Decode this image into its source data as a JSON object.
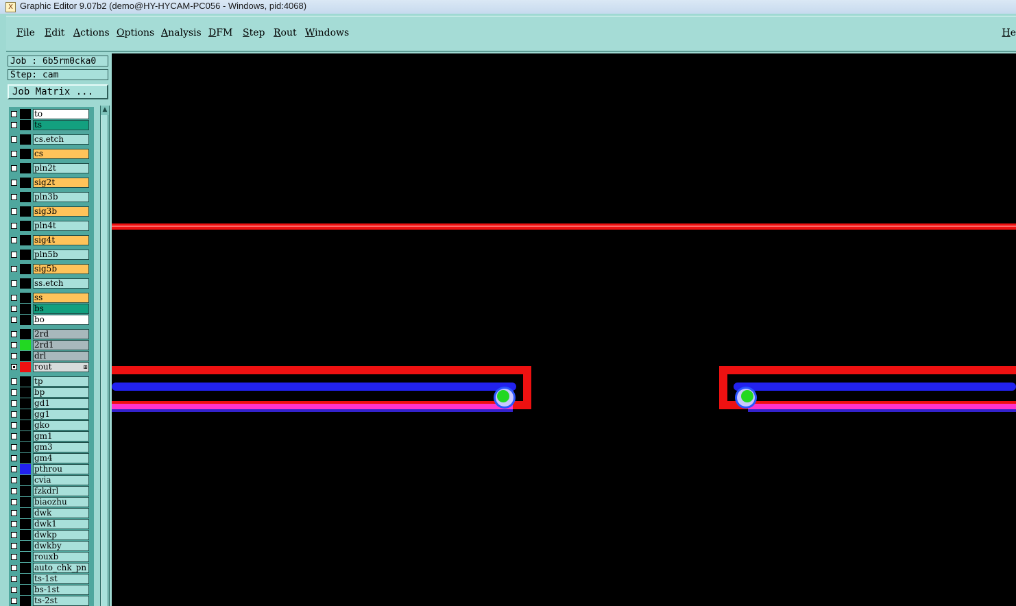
{
  "window": {
    "title": "Graphic Editor 9.07b2 (demo@HY-HYCAM-PC056 - Windows, pid:4068)",
    "icon": "app-x-icon"
  },
  "menu": {
    "items": [
      "File",
      "Edit",
      "Actions",
      "Options",
      "Analysis",
      "DFM",
      "Step",
      "Rout",
      "Windows"
    ],
    "help": "He"
  },
  "job": {
    "job_label": "Job : 6b5rm0cka0",
    "step_label": "Step: cam",
    "matrix_button": "Job Matrix ..."
  },
  "layers": [
    {
      "name": "to",
      "color": "#ffffff",
      "swatch": "#000000",
      "checked": false
    },
    {
      "name": "ts",
      "color": "#13a07f",
      "swatch": "#000000",
      "checked": false
    },
    {
      "name": "cs.etch",
      "color": "#a8e0da",
      "swatch": "#000000",
      "checked": false
    },
    {
      "name": "cs",
      "color": "#ffc35a",
      "swatch": "#000000",
      "checked": false
    },
    {
      "name": "pln2t",
      "color": "#a8e0da",
      "swatch": "#000000",
      "checked": false
    },
    {
      "name": "sig2t",
      "color": "#ffc35a",
      "swatch": "#000000",
      "checked": false
    },
    {
      "name": "pln3b",
      "color": "#a8e0da",
      "swatch": "#000000",
      "checked": false
    },
    {
      "name": "sig3b",
      "color": "#ffc35a",
      "swatch": "#000000",
      "checked": false
    },
    {
      "name": "pln4t",
      "color": "#a8e0da",
      "swatch": "#000000",
      "checked": false
    },
    {
      "name": "sig4t",
      "color": "#ffc35a",
      "swatch": "#000000",
      "checked": false
    },
    {
      "name": "pln5b",
      "color": "#a8e0da",
      "swatch": "#000000",
      "checked": false
    },
    {
      "name": "sig5b",
      "color": "#ffc35a",
      "swatch": "#000000",
      "checked": false
    },
    {
      "name": "ss.etch",
      "color": "#a8e0da",
      "swatch": "#000000",
      "checked": false
    },
    {
      "name": "ss",
      "color": "#ffc35a",
      "swatch": "#000000",
      "checked": false
    },
    {
      "name": "bs",
      "color": "#13a07f",
      "swatch": "#000000",
      "checked": false
    },
    {
      "name": "bo",
      "color": "#ffffff",
      "swatch": "#000000",
      "checked": false
    },
    {
      "name": "2rd",
      "color": "#a8b8bc",
      "swatch": "#000000",
      "checked": false
    },
    {
      "name": "2rd1",
      "color": "#a8b8bc",
      "swatch": "#22d822",
      "checked": false
    },
    {
      "name": "drl",
      "color": "#a8b8bc",
      "swatch": "#000000",
      "checked": false
    },
    {
      "name": "rout",
      "color": "#d8dcdc",
      "swatch": "#ee1111",
      "checked": true,
      "tag": "⊞"
    },
    {
      "name": "tp",
      "color": "#a8e0da",
      "swatch": "#000000",
      "checked": false
    },
    {
      "name": "bp",
      "color": "#a8e0da",
      "swatch": "#000000",
      "checked": false
    },
    {
      "name": "gd1",
      "color": "#a8e0da",
      "swatch": "#000000",
      "checked": false
    },
    {
      "name": "gg1",
      "color": "#a8e0da",
      "swatch": "#000000",
      "checked": false
    },
    {
      "name": "gko",
      "color": "#a8e0da",
      "swatch": "#000000",
      "checked": false
    },
    {
      "name": "gm1",
      "color": "#a8e0da",
      "swatch": "#000000",
      "checked": false
    },
    {
      "name": "gm3",
      "color": "#a8e0da",
      "swatch": "#000000",
      "checked": false
    },
    {
      "name": "gm4",
      "color": "#a8e0da",
      "swatch": "#000000",
      "checked": false
    },
    {
      "name": "pthrou",
      "color": "#a8e0da",
      "swatch": "#2222ee",
      "checked": false
    },
    {
      "name": "cvia",
      "color": "#a8e0da",
      "swatch": "#000000",
      "checked": false
    },
    {
      "name": "fzkdrl",
      "color": "#a8e0da",
      "swatch": "#000000",
      "checked": false
    },
    {
      "name": "biaozhu",
      "color": "#a8e0da",
      "swatch": "#000000",
      "checked": false
    },
    {
      "name": "dwk",
      "color": "#a8e0da",
      "swatch": "#000000",
      "checked": false
    },
    {
      "name": "dwk1",
      "color": "#a8e0da",
      "swatch": "#000000",
      "checked": false
    },
    {
      "name": "dwkp",
      "color": "#a8e0da",
      "swatch": "#000000",
      "checked": false
    },
    {
      "name": "dwkby",
      "color": "#a8e0da",
      "swatch": "#000000",
      "checked": false
    },
    {
      "name": "rouxb",
      "color": "#a8e0da",
      "swatch": "#000000",
      "checked": false
    },
    {
      "name": "auto_chk_pn",
      "color": "#a8e0da",
      "swatch": "#000000",
      "checked": false
    },
    {
      "name": "ts-1st",
      "color": "#a8e0da",
      "swatch": "#000000",
      "checked": false
    },
    {
      "name": "bs-1st",
      "color": "#a8e0da",
      "swatch": "#000000",
      "checked": false
    },
    {
      "name": "ts-2st",
      "color": "#a8e0da",
      "swatch": "#000000",
      "checked": false
    }
  ],
  "canvas": {
    "background": "#000000",
    "rout_color": "#ee1111",
    "pthrou_color": "#2222ee",
    "pad_color": "#ff33cc",
    "drill_color": "#22d822"
  }
}
